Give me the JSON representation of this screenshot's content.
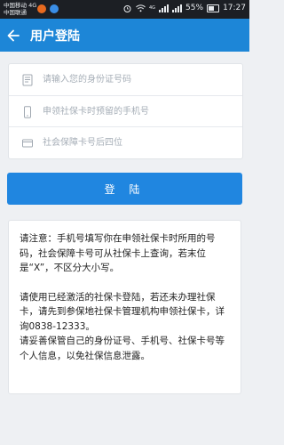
{
  "status_bar": {
    "carrier_1": "中国移动 4G",
    "carrier_2": "中国联通",
    "network": "4G",
    "battery": "55%",
    "time": "17:27"
  },
  "header": {
    "title": "用户登陆",
    "back_icon": "arrow-left-icon"
  },
  "form": {
    "id_placeholder": "请输入您的身份证号码",
    "phone_placeholder": "申领社保卡时预留的手机号",
    "card_placeholder": "社会保障卡号后四位"
  },
  "login_button": "登  陆",
  "notice": {
    "para1": "请注意：手机号填写你在申领社保卡时所用的号码，社会保障卡号可从社保卡上查询，若末位是“X”，不区分大小写。",
    "para2": "请使用已经激活的社保卡登陆，若还未办理社保卡，请先到参保地社保卡管理机构申领社保卡，详询0838-12333。",
    "para3": "请妥善保管自己的身份证号、手机号、社保卡号等个人信息，以免社保信息泄露。"
  },
  "colors": {
    "primary": "#1d86d7",
    "button": "#2086e0",
    "background": "#eef0f3"
  }
}
